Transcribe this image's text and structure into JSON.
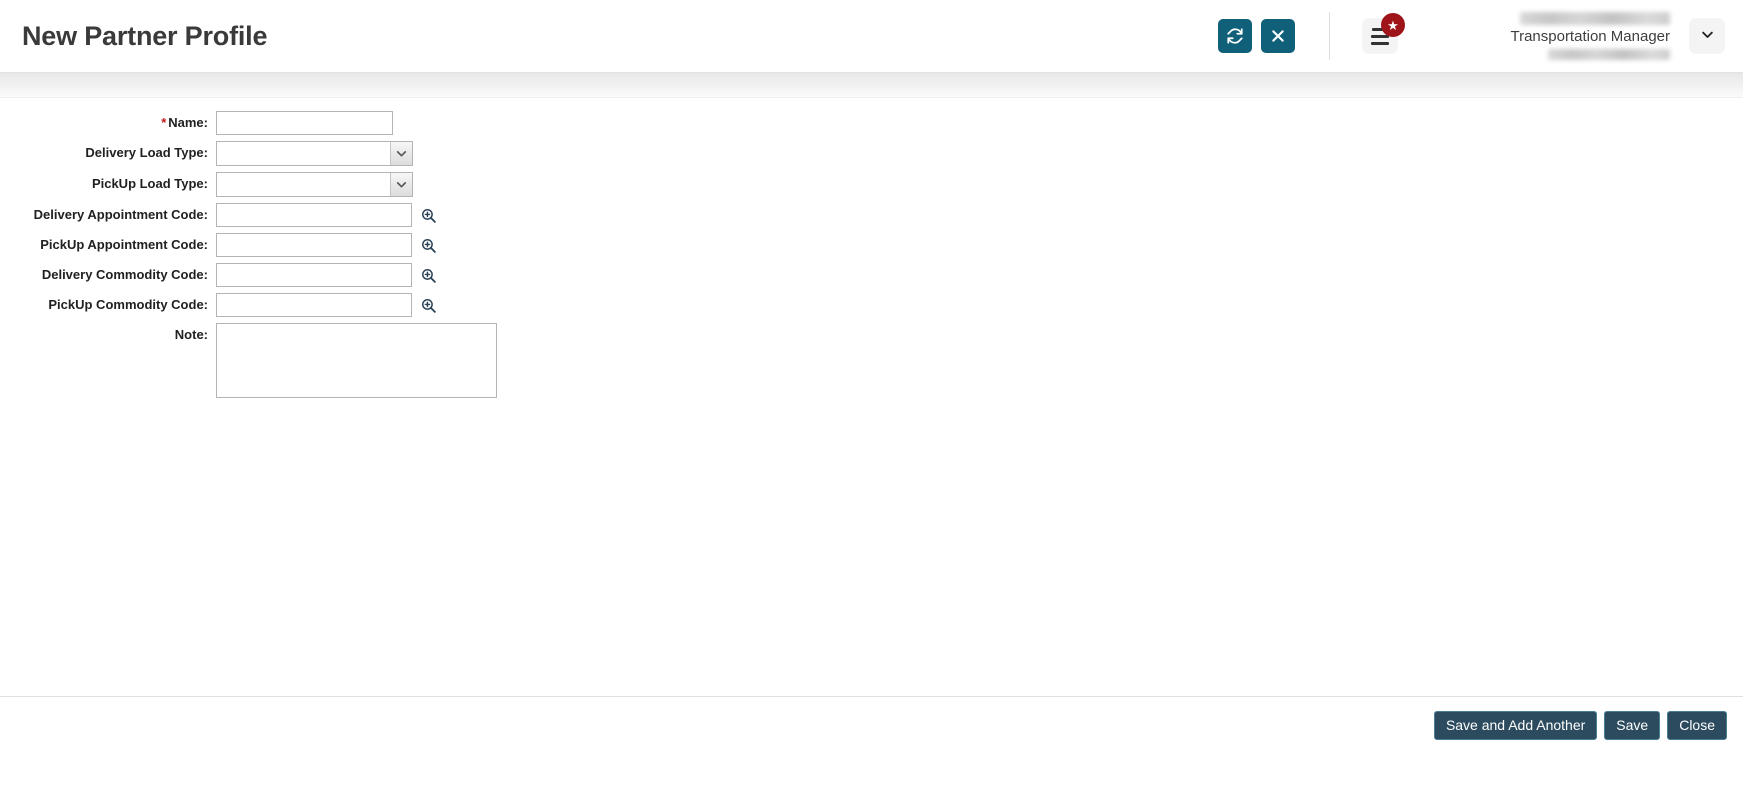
{
  "header": {
    "title": "New Partner Profile",
    "refresh_icon": "refresh-icon",
    "close_icon": "close-icon",
    "menu_icon": "hamburger-menu-icon",
    "badge_icon": "star-badge-icon",
    "badge_glyph": "★",
    "user_role": "Transportation Manager",
    "user_name_redacted": "",
    "user_meta_redacted": "",
    "chevron_icon": "chevron-down-icon"
  },
  "form": {
    "fields": [
      {
        "label": "Name:",
        "required": true,
        "type": "text",
        "value": ""
      },
      {
        "label": "Delivery Load Type:",
        "required": false,
        "type": "select",
        "value": ""
      },
      {
        "label": "PickUp Load Type:",
        "required": false,
        "type": "select",
        "value": ""
      },
      {
        "label": "Delivery Appointment Code:",
        "required": false,
        "type": "lookup",
        "value": ""
      },
      {
        "label": "PickUp Appointment Code:",
        "required": false,
        "type": "lookup",
        "value": ""
      },
      {
        "label": "Delivery Commodity Code:",
        "required": false,
        "type": "lookup",
        "value": ""
      },
      {
        "label": "PickUp Commodity Code:",
        "required": false,
        "type": "lookup",
        "value": ""
      },
      {
        "label": "Note:",
        "required": false,
        "type": "textarea",
        "value": ""
      }
    ],
    "lookup_icon": "magnifier-plus-icon",
    "dropdown_icon": "chevron-down-icon"
  },
  "footer": {
    "save_and_add_another_label": "Save and Add Another",
    "save_label": "Save",
    "close_label": "Close"
  },
  "colors": {
    "teal_button": "#10607a",
    "footer_button": "#2c4b5e",
    "footer_button_border": "#4a7e96",
    "badge_red": "#9e1419",
    "required_star": "#c01a1a",
    "title_text": "#3a3a3a"
  }
}
